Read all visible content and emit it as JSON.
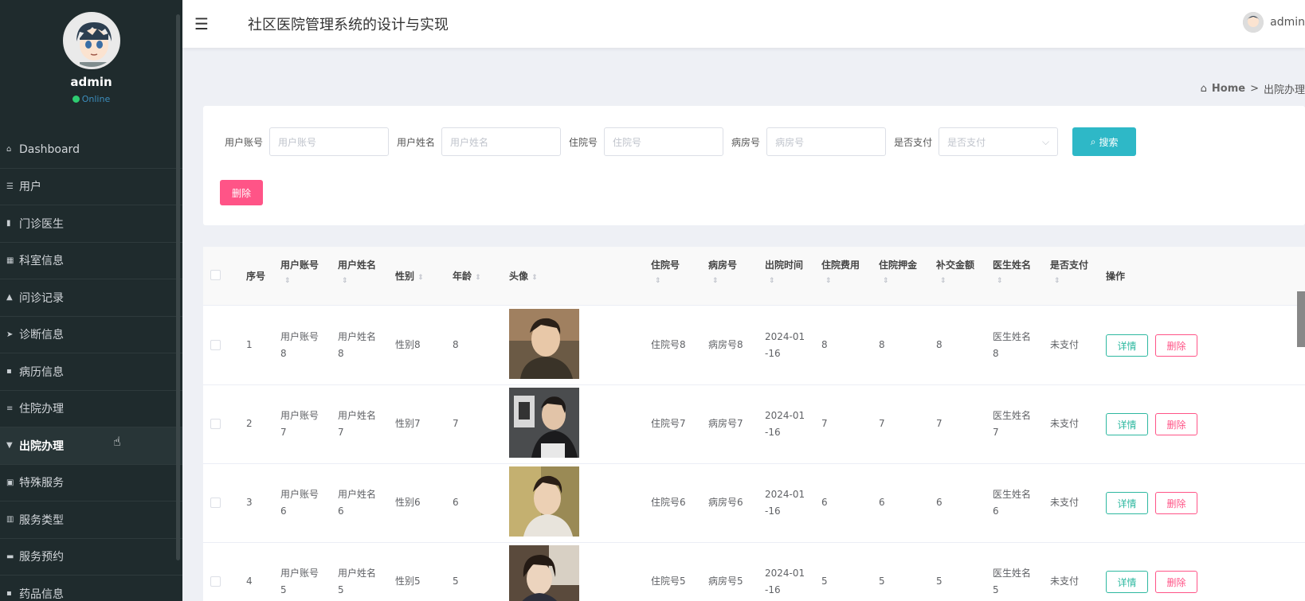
{
  "user": {
    "name": "admin",
    "status": "Online"
  },
  "app": {
    "title": "社区医院管理系统的设计与实现"
  },
  "sidebar": {
    "items": [
      {
        "label": "Dashboard",
        "icon": "home-icon"
      },
      {
        "label": "用户",
        "icon": "sliders-icon"
      },
      {
        "label": "门诊医生",
        "icon": "book-icon"
      },
      {
        "label": "科室信息",
        "icon": "grid-icon"
      },
      {
        "label": "问诊记录",
        "icon": "thumb-icon"
      },
      {
        "label": "诊断信息",
        "icon": "send-icon"
      },
      {
        "label": "病历信息",
        "icon": "apps-icon"
      },
      {
        "label": "住院办理",
        "icon": "list-icon"
      },
      {
        "label": "出院办理",
        "icon": "trophy-icon",
        "active": true
      },
      {
        "label": "特殊服务",
        "icon": "clipboard-icon"
      },
      {
        "label": "服务类型",
        "icon": "bar-chart-icon"
      },
      {
        "label": "服务预约",
        "icon": "monitor-icon"
      },
      {
        "label": "药品信息",
        "icon": "apps-icon"
      }
    ]
  },
  "breadcrumb": {
    "home": "Home",
    "separator": ">",
    "current": "出院办理"
  },
  "search": {
    "fields": [
      {
        "label": "用户账号",
        "placeholder": "用户账号"
      },
      {
        "label": "用户姓名",
        "placeholder": "用户姓名"
      },
      {
        "label": "住院号",
        "placeholder": "住院号"
      },
      {
        "label": "病房号",
        "placeholder": "病房号"
      }
    ],
    "select": {
      "label": "是否支付",
      "placeholder": "是否支付"
    },
    "button": "搜索",
    "delete_button": "删除"
  },
  "table": {
    "headers": {
      "index": "序号",
      "account": "用户账号",
      "name": "用户姓名",
      "gender": "性别",
      "age": "年龄",
      "avatar": "头像",
      "admission_no": "住院号",
      "ward_no": "病房号",
      "discharge_time": "出院时间",
      "fee": "住院费用",
      "deposit": "住院押金",
      "supplement": "补交金额",
      "doctor": "医生姓名",
      "paid": "是否支付",
      "actions": "操作"
    },
    "rows": [
      {
        "index": "1",
        "account_a": "用户账号",
        "account_b": "8",
        "name_a": "用户姓名",
        "name_b": "8",
        "gender": "性别8",
        "age": "8",
        "admission_no": "住院号8",
        "ward_no": "病房号8",
        "date_a": "2024-01",
        "date_b": "-16",
        "fee": "8",
        "deposit": "8",
        "supplement": "8",
        "doctor_a": "医生姓名",
        "doctor_b": "8",
        "paid": "未支付",
        "detail": "详情",
        "delete": "删除"
      },
      {
        "index": "2",
        "account_a": "用户账号",
        "account_b": "7",
        "name_a": "用户姓名",
        "name_b": "7",
        "gender": "性别7",
        "age": "7",
        "admission_no": "住院号7",
        "ward_no": "病房号7",
        "date_a": "2024-01",
        "date_b": "-16",
        "fee": "7",
        "deposit": "7",
        "supplement": "7",
        "doctor_a": "医生姓名",
        "doctor_b": "7",
        "paid": "未支付",
        "detail": "详情",
        "delete": "删除"
      },
      {
        "index": "3",
        "account_a": "用户账号",
        "account_b": "6",
        "name_a": "用户姓名",
        "name_b": "6",
        "gender": "性别6",
        "age": "6",
        "admission_no": "住院号6",
        "ward_no": "病房号6",
        "date_a": "2024-01",
        "date_b": "-16",
        "fee": "6",
        "deposit": "6",
        "supplement": "6",
        "doctor_a": "医生姓名",
        "doctor_b": "6",
        "paid": "未支付",
        "detail": "详情",
        "delete": "删除"
      },
      {
        "index": "4",
        "account_a": "用户账号",
        "account_b": "5",
        "name_a": "用户姓名",
        "name_b": "5",
        "gender": "性别5",
        "age": "5",
        "admission_no": "住院号5",
        "ward_no": "病房号5",
        "date_a": "2024-01",
        "date_b": "-16",
        "fee": "5",
        "deposit": "5",
        "supplement": "5",
        "doctor_a": "医生姓名",
        "doctor_b": "5",
        "paid": "未支付",
        "detail": "详情",
        "delete": "删除"
      }
    ]
  }
}
